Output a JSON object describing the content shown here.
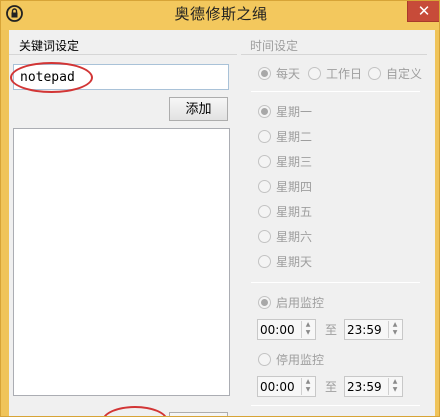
{
  "window": {
    "title": "奥德修斯之绳",
    "close_glyph": "✕"
  },
  "keywords": {
    "group_label": "关键词设定",
    "input_value": "notepad",
    "add_label": "添加",
    "items": []
  },
  "time": {
    "group_label": "时间设定",
    "frequency": [
      {
        "label": "每天",
        "checked": true
      },
      {
        "label": "工作日",
        "checked": false
      },
      {
        "label": "自定义",
        "checked": false
      }
    ],
    "weekdays": [
      {
        "label": "星期一",
        "checked": true
      },
      {
        "label": "星期二",
        "checked": false
      },
      {
        "label": "星期三",
        "checked": false
      },
      {
        "label": "星期四",
        "checked": false
      },
      {
        "label": "星期五",
        "checked": false
      },
      {
        "label": "星期六",
        "checked": false
      },
      {
        "label": "星期天",
        "checked": false
      }
    ],
    "enable_monitor": {
      "label": "启用监控",
      "checked": true,
      "from": "00:00",
      "to_label": "至",
      "to": "23:59"
    },
    "disable_monitor": {
      "label": "停用监控",
      "checked": false,
      "from": "00:00",
      "to_label": "至",
      "to": "23:59"
    }
  },
  "colors": {
    "title_bar": "#f3c85d",
    "close_button": "#c74b39",
    "annotation_oval": "#d23535"
  }
}
